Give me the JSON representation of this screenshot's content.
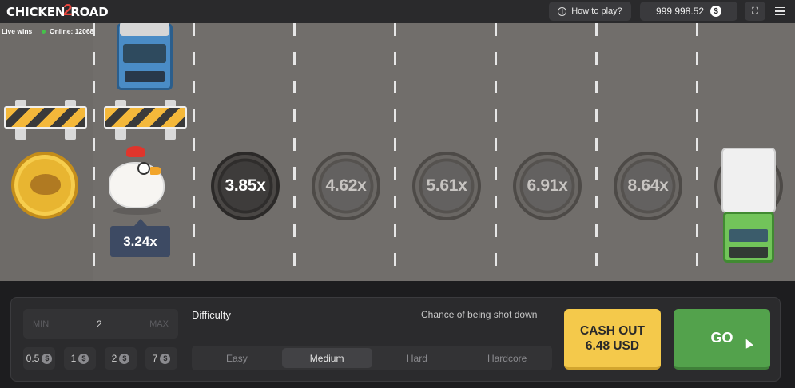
{
  "header": {
    "logo_text_left": "CHICKEN",
    "logo_text_mid": "2",
    "logo_text_right": "ROAD",
    "how_to_play": "How to play?",
    "balance": "999 998.52",
    "currency_symbol": "$"
  },
  "status": {
    "live_wins": "Live wins",
    "online": "Online: 12068"
  },
  "road": {
    "current_multiplier": "3.24x",
    "multipliers": [
      "3.85x",
      "4.62x",
      "5.61x",
      "6.91x",
      "8.64x"
    ]
  },
  "controls": {
    "bet_min_label": "MIN",
    "bet_value": "2",
    "bet_max_label": "MAX",
    "chips": [
      "0.5",
      "1",
      "2",
      "7"
    ],
    "chip_symbol": "$",
    "difficulty_label": "Difficulty",
    "chance_label": "Chance of being shot down",
    "difficulty_tabs": [
      "Easy",
      "Medium",
      "Hard",
      "Hardcore"
    ],
    "selected_difficulty": "Medium",
    "cashout_line1": "CASH OUT",
    "cashout_line2": "6.48 USD",
    "go_label": "GO"
  },
  "colors": {
    "road": "#716e6b",
    "cashout": "#f4c94b",
    "go": "#53a24c",
    "multiplier_tag": "#3d4a63"
  }
}
